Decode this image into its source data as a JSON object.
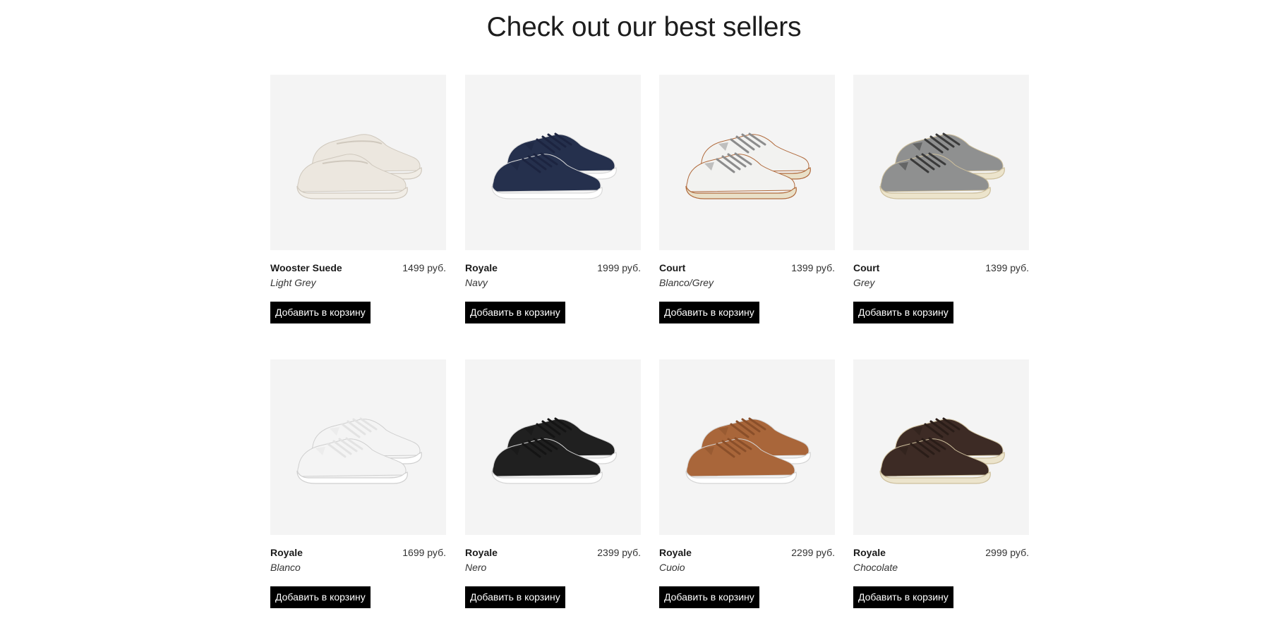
{
  "page_title": "Check out our best sellers",
  "products": [
    {
      "name": "Wooster Suede",
      "variant": "Light Grey",
      "price": "1499 руб.",
      "button_label": "Добавить в корзину",
      "icon": "slip-on-sneaker-icon",
      "colors": {
        "upper": "#ece7df",
        "sole": "#f1ede6",
        "lace": "#ece7df",
        "edge": "#cfc8bd"
      }
    },
    {
      "name": "Royale",
      "variant": "Navy",
      "price": "1999 руб.",
      "button_label": "Добавить в корзину",
      "icon": "sneaker-icon",
      "colors": {
        "upper": "#25304d",
        "sole": "#ffffff",
        "lace": "#1c2440",
        "edge": "#d9d9d9"
      }
    },
    {
      "name": "Court",
      "variant": "Blanco/Grey",
      "price": "1399 руб.",
      "button_label": "Добавить в корзину",
      "icon": "sneaker-icon",
      "colors": {
        "upper": "#f2f2f0",
        "sole": "#e9e0c8",
        "lace": "#8c8c8c",
        "edge": "#b06a3c"
      }
    },
    {
      "name": "Court",
      "variant": "Grey",
      "price": "1399 руб.",
      "button_label": "Добавить в корзину",
      "icon": "sneaker-icon",
      "colors": {
        "upper": "#8f9090",
        "sole": "#ece4cc",
        "lace": "#3a3a3a",
        "edge": "#cdbf9c"
      }
    },
    {
      "name": "Royale",
      "variant": "Blanco",
      "price": "1699 руб.",
      "button_label": "Добавить в корзину",
      "icon": "sneaker-icon",
      "colors": {
        "upper": "#f4f4f4",
        "sole": "#ffffff",
        "lace": "#e3e3e3",
        "edge": "#cfcfcf"
      }
    },
    {
      "name": "Royale",
      "variant": "Nero",
      "price": "2399 руб.",
      "button_label": "Добавить в корзину",
      "icon": "sneaker-icon",
      "colors": {
        "upper": "#202020",
        "sole": "#ffffff",
        "lace": "#141414",
        "edge": "#d4d4d4"
      }
    },
    {
      "name": "Royale",
      "variant": "Cuoio",
      "price": "2299 руб.",
      "button_label": "Добавить в корзину",
      "icon": "sneaker-icon",
      "colors": {
        "upper": "#a9663a",
        "sole": "#ffffff",
        "lace": "#8a4f2a",
        "edge": "#d4d4d4"
      }
    },
    {
      "name": "Royale",
      "variant": "Chocolate",
      "price": "2999 руб.",
      "button_label": "Добавить в корзину",
      "icon": "sneaker-icon",
      "colors": {
        "upper": "#3d2b25",
        "sole": "#ece4cc",
        "lace": "#2a1d18",
        "edge": "#cdbf9c"
      }
    }
  ]
}
